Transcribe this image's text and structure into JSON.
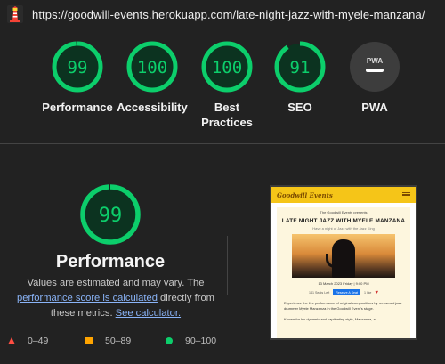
{
  "header": {
    "url": "https://goodwill-events.herokuapp.com/late-night-jazz-with-myele-manzana/",
    "logo_icon": "lighthouse-icon"
  },
  "scores": [
    {
      "label": "Performance",
      "value": "99",
      "fraction": 0.99
    },
    {
      "label": "Accessibility",
      "value": "100",
      "fraction": 1.0
    },
    {
      "label": "Best Practices",
      "value": "100",
      "fraction": 1.0
    },
    {
      "label": "SEO",
      "value": "91",
      "fraction": 0.91
    },
    {
      "label": "PWA",
      "value": "",
      "badge": "PWA"
    }
  ],
  "detail": {
    "score": "99",
    "fraction": 0.99,
    "title": "Performance",
    "desc_start": "Values are estimated and may vary. The ",
    "link_score": "performance score is calculated",
    "desc_mid": " directly from these metrics. ",
    "link_calc": "See calculator."
  },
  "legend": [
    {
      "icon": "red-triangle-icon",
      "range": "0–49"
    },
    {
      "icon": "orange-square-icon",
      "range": "50–89"
    },
    {
      "icon": "green-circle-icon",
      "range": "90–100"
    }
  ],
  "thumbnail": {
    "brand": "Goodwill Events",
    "presents": "The Goodwill Events presents",
    "title": "LATE NIGHT JAZZ WITH MYELE MANZANA",
    "subtitle": "Have a night of Jazz with the Jazz King",
    "date": "13 March 2023 Friday | 9:00 PM",
    "seats": "141 Seats Left",
    "button": "Reserve A Seat",
    "likes": "1 like",
    "para1": "Experience the live performance of original compositions by renowned jazz drummer Myele Manzanza in the Goodwill Event's stage.",
    "para2": "Known for his dynamic and captivating style, Manzanza, a"
  },
  "colors": {
    "pass": "#0cce6b",
    "average": "#ffa400",
    "fail": "#ff4e42",
    "background": "#222222",
    "link": "#8ab4f8"
  }
}
